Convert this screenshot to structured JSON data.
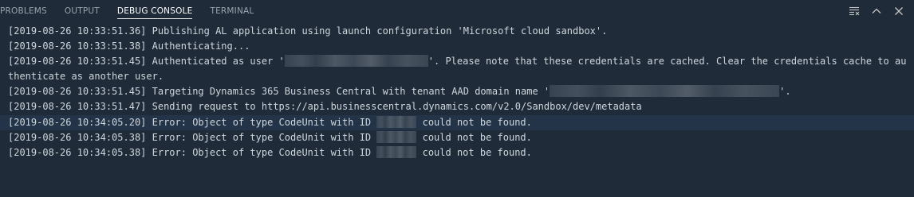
{
  "tabs": [
    {
      "label": "PROBLEMS",
      "active": false
    },
    {
      "label": "OUTPUT",
      "active": false
    },
    {
      "label": "DEBUG CONSOLE",
      "active": true
    },
    {
      "label": "TERMINAL",
      "active": false
    }
  ],
  "actions": [
    {
      "icon": "clear-console-icon"
    },
    {
      "icon": "chevron-up-icon"
    },
    {
      "icon": "close-icon"
    }
  ],
  "colors": {
    "panel_bg": "#1f2b38",
    "text": "#cfd6dd",
    "tab_inactive": "#9aa4ae",
    "tab_active": "#ffffff",
    "line_highlight": "#233448"
  },
  "console": {
    "lines": [
      {
        "ts": "[2019-08-26 10:33:51.36]",
        "a": " Publishing AL application using launch configuration 'Microsoft cloud sandbox'."
      },
      {
        "ts": "[2019-08-26 10:33:51.38]",
        "a": " Authenticating..."
      },
      {
        "ts": "[2019-08-26 10:33:51.45]",
        "a": " Authenticated as user '",
        "b": "'. Please note that these credentials are cached. Clear the credentials cache to authenticate as another user."
      },
      {
        "ts": "[2019-08-26 10:33:51.45]",
        "a": " Targeting Dynamics 365 Business Central with tenant AAD domain name '",
        "b": "'."
      },
      {
        "ts": "[2019-08-26 10:33:51.47]",
        "a": " Sending request to https://api.businesscentral.dynamics.com/v2.0/Sandbox/dev/metadata"
      },
      {
        "ts": "[2019-08-26 10:34:05.20]",
        "a": " Error: Object of type CodeUnit with ID ",
        "b": " could not be found."
      },
      {
        "ts": "[2019-08-26 10:34:05.38]",
        "a": " Error: Object of type CodeUnit with ID ",
        "b": " could not be found."
      },
      {
        "ts": "[2019-08-26 10:34:05.38]",
        "a": " Error: Object of type CodeUnit with ID ",
        "b": " could not be found."
      }
    ]
  }
}
